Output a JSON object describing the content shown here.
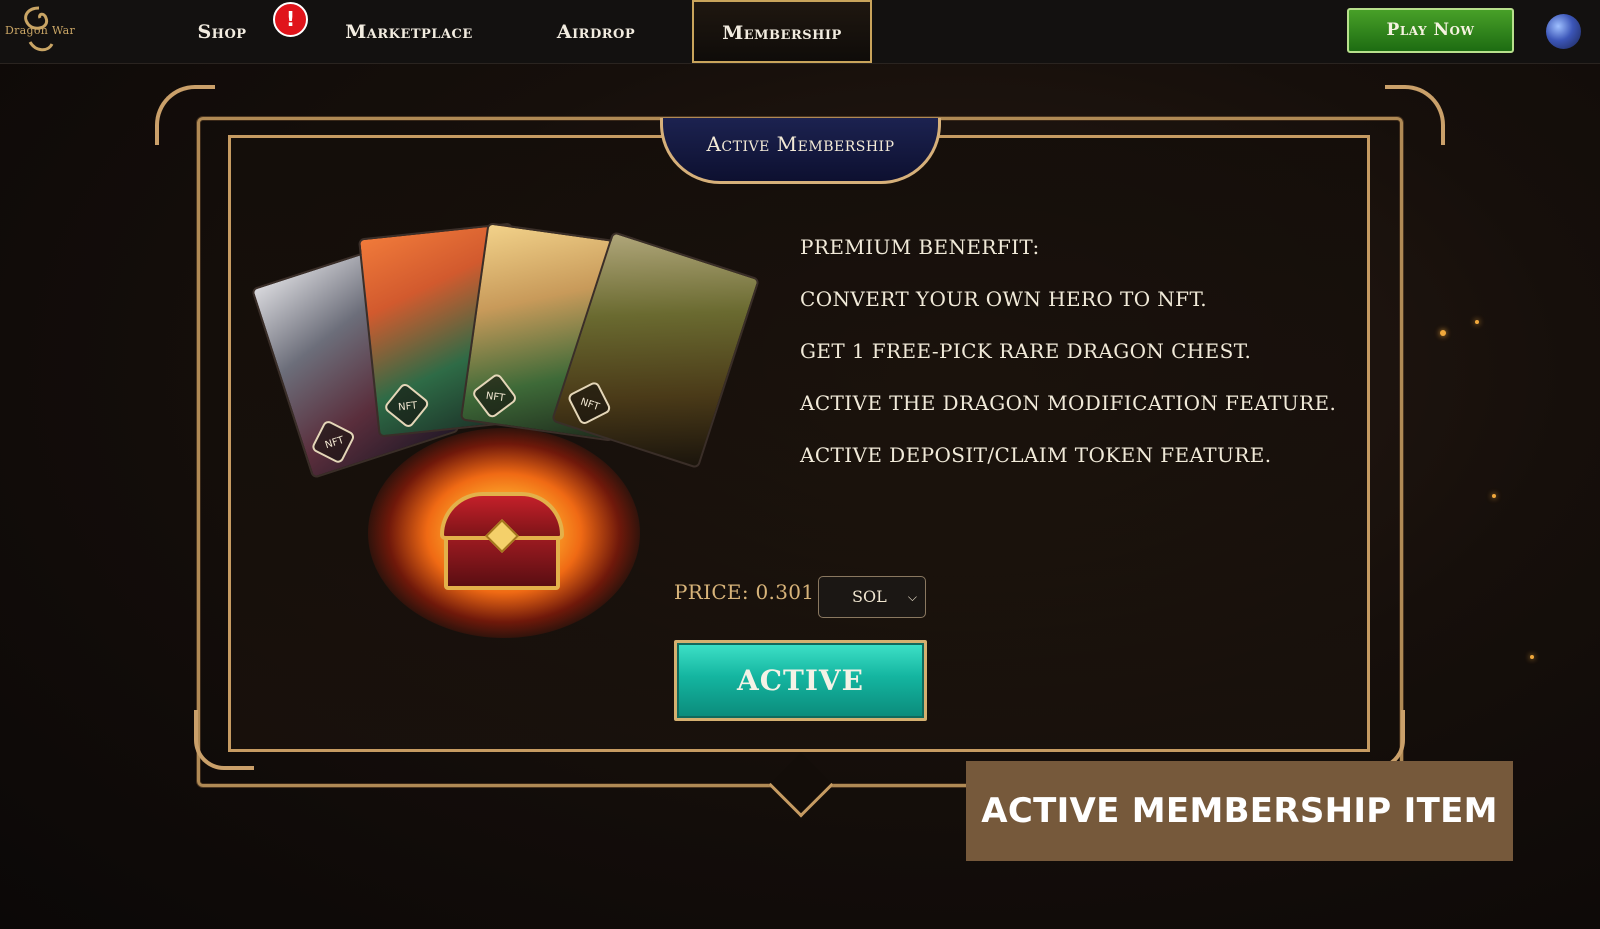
{
  "nav": {
    "logo_text": "Dragon War",
    "items": [
      {
        "label": "Shop"
      },
      {
        "label": "Marketplace"
      },
      {
        "label": "Airdrop"
      },
      {
        "label": "Membership"
      }
    ],
    "alert_badge": "!",
    "play_button": "Play Now"
  },
  "membership": {
    "title": "Active Membership",
    "benefits": [
      "PREMIUM BENERFIT:",
      "CONVERT YOUR OWN HERO TO NFT.",
      "GET 1 FREE-PICK RARE DRAGON CHEST.",
      "ACTIVE THE DRAGON MODIFICATION FEATURE.",
      "ACTIVE DEPOSIT/CLAIM TOKEN FEATURE."
    ],
    "price_label": "PRICE: 0.301",
    "currency": "SOL",
    "nft_badge": "NFT",
    "active_button": "ACTIVE"
  },
  "caption": "ACTIVE MEMBERSHIP ITEM",
  "colors": {
    "accent_gold": "#c69b62",
    "active_button": "#14b5a0",
    "play_button": "#2e8a1c",
    "caption_bg": "#76593b"
  }
}
